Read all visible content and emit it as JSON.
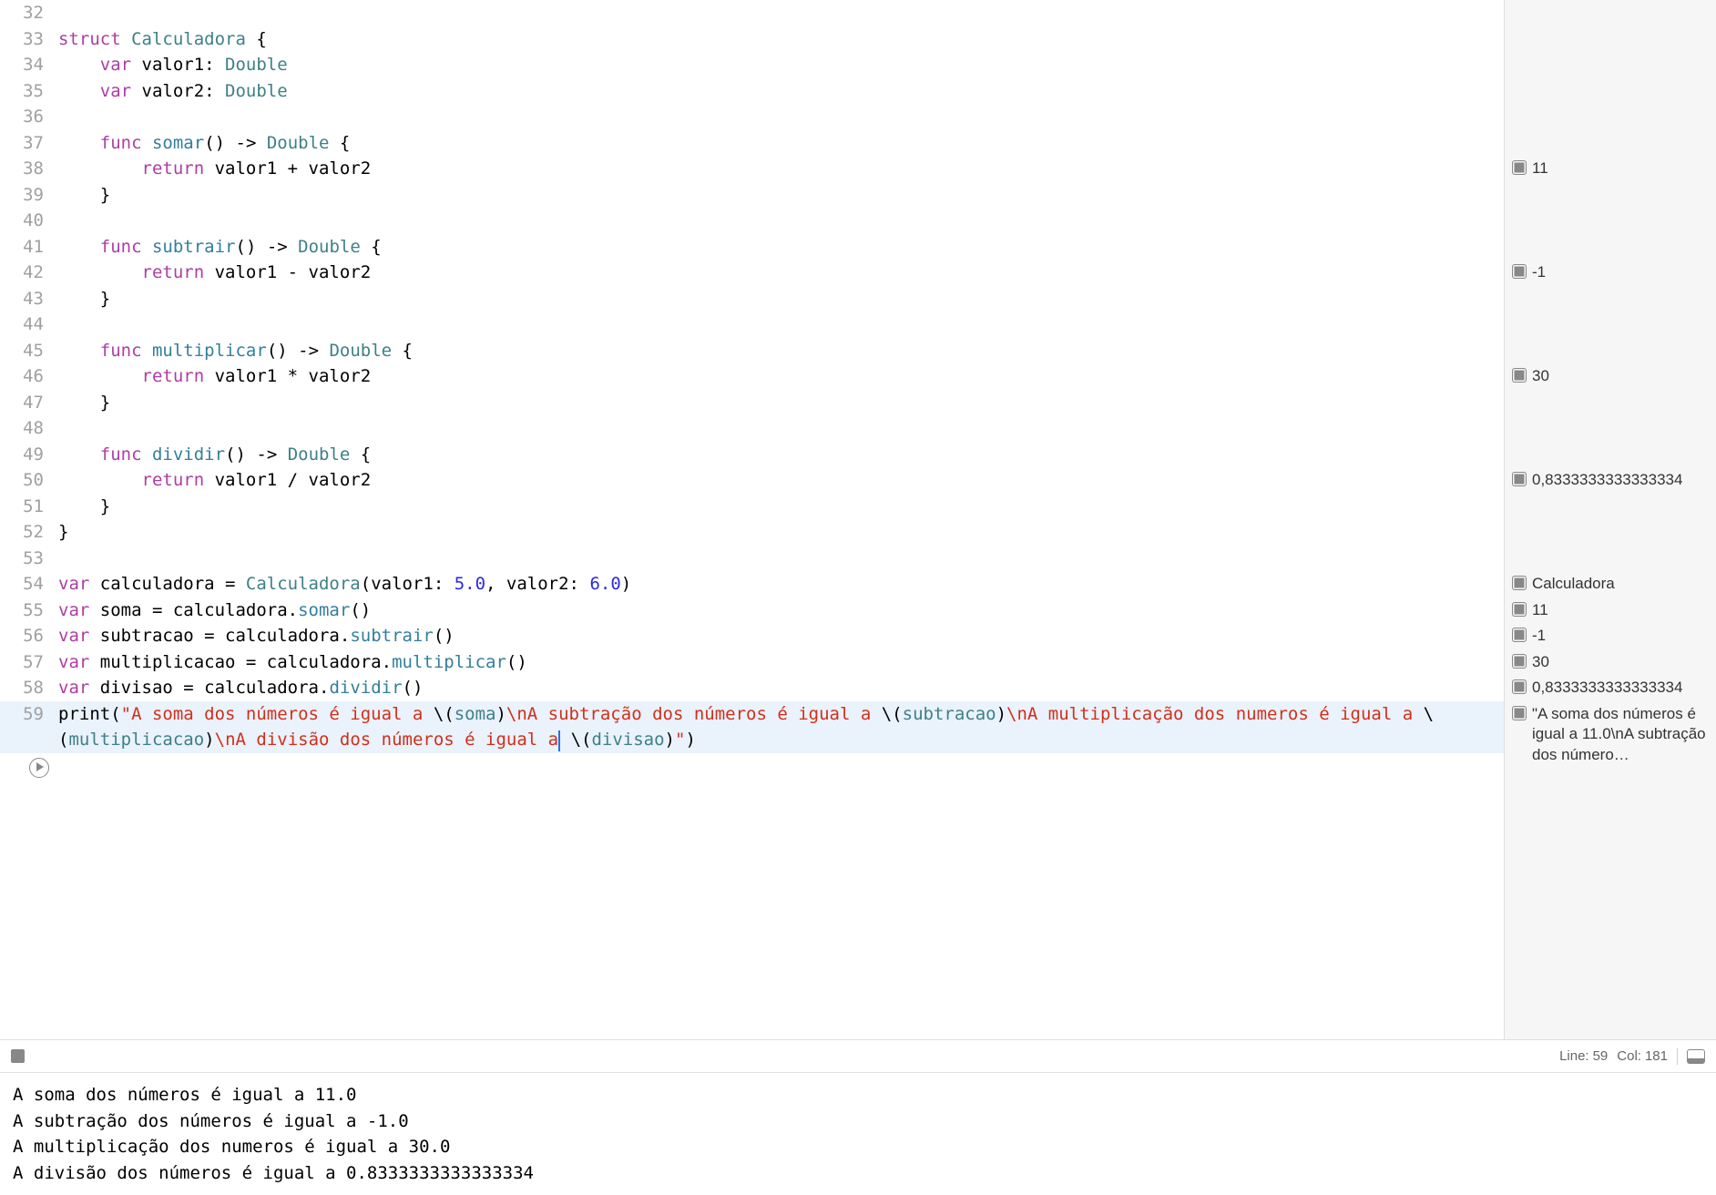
{
  "status": {
    "line_label": "Line:",
    "line_value": "59",
    "col_label": "Col:",
    "col_value": "181"
  },
  "code": {
    "lines": [
      {
        "num": "32",
        "tokens": []
      },
      {
        "num": "33",
        "tokens": [
          [
            "kw",
            "struct"
          ],
          [
            "p",
            " "
          ],
          [
            "type",
            "Calculadora"
          ],
          [
            "p",
            " {"
          ]
        ]
      },
      {
        "num": "34",
        "tokens": [
          [
            "p",
            "    "
          ],
          [
            "kw",
            "var"
          ],
          [
            "p",
            " valor1: "
          ],
          [
            "type",
            "Double"
          ]
        ]
      },
      {
        "num": "35",
        "tokens": [
          [
            "p",
            "    "
          ],
          [
            "kw",
            "var"
          ],
          [
            "p",
            " valor2: "
          ],
          [
            "type",
            "Double"
          ]
        ]
      },
      {
        "num": "36",
        "tokens": []
      },
      {
        "num": "37",
        "tokens": [
          [
            "p",
            "    "
          ],
          [
            "kw",
            "func"
          ],
          [
            "p",
            " "
          ],
          [
            "func",
            "somar"
          ],
          [
            "p",
            "() -> "
          ],
          [
            "type",
            "Double"
          ],
          [
            "p",
            " {"
          ]
        ]
      },
      {
        "num": "38",
        "tokens": [
          [
            "p",
            "        "
          ],
          [
            "kw",
            "return"
          ],
          [
            "p",
            " valor1 + valor2"
          ]
        ],
        "result": "11"
      },
      {
        "num": "39",
        "tokens": [
          [
            "p",
            "    }"
          ]
        ]
      },
      {
        "num": "40",
        "tokens": []
      },
      {
        "num": "41",
        "tokens": [
          [
            "p",
            "    "
          ],
          [
            "kw",
            "func"
          ],
          [
            "p",
            " "
          ],
          [
            "func",
            "subtrair"
          ],
          [
            "p",
            "() -> "
          ],
          [
            "type",
            "Double"
          ],
          [
            "p",
            " {"
          ]
        ]
      },
      {
        "num": "42",
        "tokens": [
          [
            "p",
            "        "
          ],
          [
            "kw",
            "return"
          ],
          [
            "p",
            " valor1 - valor2"
          ]
        ],
        "result": "-1"
      },
      {
        "num": "43",
        "tokens": [
          [
            "p",
            "    }"
          ]
        ]
      },
      {
        "num": "44",
        "tokens": []
      },
      {
        "num": "45",
        "tokens": [
          [
            "p",
            "    "
          ],
          [
            "kw",
            "func"
          ],
          [
            "p",
            " "
          ],
          [
            "func",
            "multiplicar"
          ],
          [
            "p",
            "() -> "
          ],
          [
            "type",
            "Double"
          ],
          [
            "p",
            " {"
          ]
        ]
      },
      {
        "num": "46",
        "tokens": [
          [
            "p",
            "        "
          ],
          [
            "kw",
            "return"
          ],
          [
            "p",
            " valor1 * valor2"
          ]
        ],
        "result": "30"
      },
      {
        "num": "47",
        "tokens": [
          [
            "p",
            "    }"
          ]
        ]
      },
      {
        "num": "48",
        "tokens": []
      },
      {
        "num": "49",
        "tokens": [
          [
            "p",
            "    "
          ],
          [
            "kw",
            "func"
          ],
          [
            "p",
            " "
          ],
          [
            "func",
            "dividir"
          ],
          [
            "p",
            "() -> "
          ],
          [
            "type",
            "Double"
          ],
          [
            "p",
            " {"
          ]
        ]
      },
      {
        "num": "50",
        "tokens": [
          [
            "p",
            "        "
          ],
          [
            "kw",
            "return"
          ],
          [
            "p",
            " valor1 / valor2"
          ]
        ],
        "result": "0,8333333333333334"
      },
      {
        "num": "51",
        "tokens": [
          [
            "p",
            "    }"
          ]
        ]
      },
      {
        "num": "52",
        "tokens": [
          [
            "p",
            "}"
          ]
        ]
      },
      {
        "num": "53",
        "tokens": []
      },
      {
        "num": "54",
        "tokens": [
          [
            "kw",
            "var"
          ],
          [
            "p",
            " calculadora = "
          ],
          [
            "type",
            "Calculadora"
          ],
          [
            "p",
            "(valor1: "
          ],
          [
            "num",
            "5.0"
          ],
          [
            "p",
            ", valor2: "
          ],
          [
            "num",
            "6.0"
          ],
          [
            "p",
            ")"
          ]
        ],
        "result": "Calculadora"
      },
      {
        "num": "55",
        "tokens": [
          [
            "kw",
            "var"
          ],
          [
            "p",
            " soma = calculadora."
          ],
          [
            "func",
            "somar"
          ],
          [
            "p",
            "()"
          ]
        ],
        "result": "11"
      },
      {
        "num": "56",
        "tokens": [
          [
            "kw",
            "var"
          ],
          [
            "p",
            " subtracao = calculadora."
          ],
          [
            "func",
            "subtrair"
          ],
          [
            "p",
            "()"
          ]
        ],
        "result": "-1"
      },
      {
        "num": "57",
        "tokens": [
          [
            "kw",
            "var"
          ],
          [
            "p",
            " multiplicacao = calculadora."
          ],
          [
            "func",
            "multiplicar"
          ],
          [
            "p",
            "()"
          ]
        ],
        "result": "30"
      },
      {
        "num": "58",
        "tokens": [
          [
            "kw",
            "var"
          ],
          [
            "p",
            " divisao = calculadora."
          ],
          [
            "func",
            "dividir"
          ],
          [
            "p",
            "()"
          ]
        ],
        "result": "0,8333333333333334"
      },
      {
        "num": "59",
        "highlighted": true,
        "wrap": true,
        "result": "\"A soma dos números é igual a 11.0\\nA subtração dos número…",
        "tokens": [
          [
            "p",
            "print("
          ],
          [
            "str",
            "\"A soma dos números é igual a "
          ],
          [
            "p",
            "\\("
          ],
          [
            "interp",
            "soma"
          ],
          [
            "p",
            ")"
          ],
          [
            "str",
            "\\nA subtração dos números é igual a "
          ],
          [
            "p",
            "\\("
          ],
          [
            "interp",
            "subtracao"
          ],
          [
            "p",
            ")"
          ],
          [
            "str",
            "\\nA multiplicação dos numeros é igual a "
          ],
          [
            "p",
            "\\("
          ],
          [
            "interp",
            "multiplicacao"
          ],
          [
            "p",
            ")"
          ],
          [
            "str",
            "\\nA divisão dos números é igual a"
          ],
          [
            "cursor",
            ""
          ],
          [
            "str",
            " "
          ],
          [
            "p",
            "\\("
          ],
          [
            "interp",
            "divisao"
          ],
          [
            "p",
            ")"
          ],
          [
            "str",
            "\""
          ],
          [
            "p",
            ")"
          ]
        ]
      }
    ]
  },
  "console_lines": [
    "A soma dos números é igual a 11.0",
    "A subtração dos números é igual a -1.0",
    "A multiplicação dos numeros é igual a 30.0",
    "A divisão dos números é igual a 0.8333333333333334"
  ]
}
